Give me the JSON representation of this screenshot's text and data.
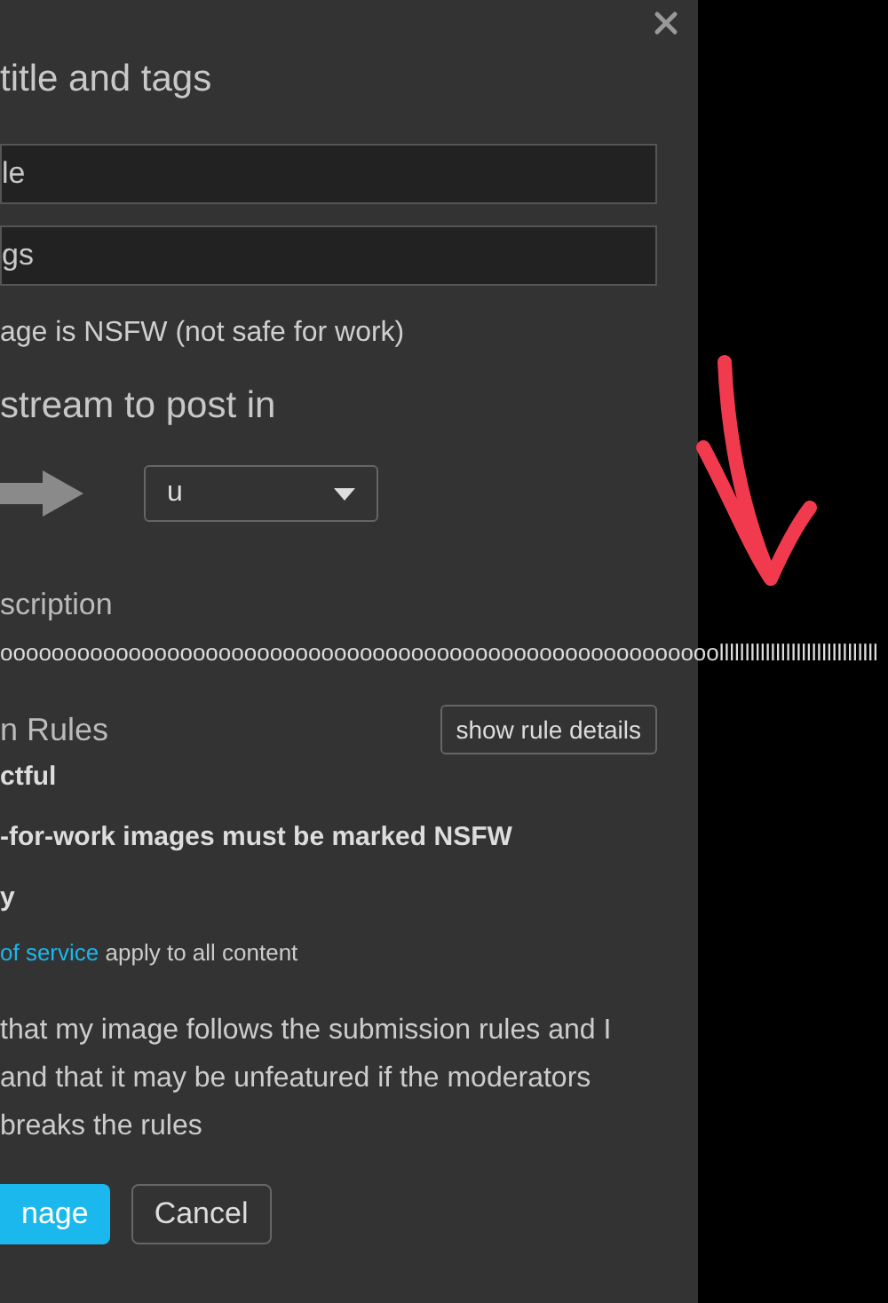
{
  "dialog": {
    "heading": "title and tags",
    "title_field": {
      "placeholder": "le"
    },
    "tags_field": {
      "placeholder": "gs"
    },
    "nsfw_label": "age is NSFW (not safe for work)",
    "stream_heading": "stream to post in",
    "stream_select": {
      "value": "u"
    },
    "description_label": "scription",
    "description_text": "oooooooooooooooooooooooooooooooooooooooooooooooooooooooolllllllllllllllllllllllllllllll",
    "rules": {
      "heading": "n Rules",
      "details_button": "show rule details",
      "items": [
        "ctful",
        "-for-work images must be marked NSFW",
        "y"
      ],
      "terms": {
        "link": "of service",
        "text": "apply to all content"
      }
    },
    "agreement": [
      "that my image follows the submission rules and I",
      "and that it may be unfeatured if the moderators",
      "breaks the rules"
    ],
    "buttons": [
      {
        "label": "nage",
        "kind": "primary"
      },
      {
        "label": "Cancel",
        "kind": "secondary"
      }
    ]
  }
}
